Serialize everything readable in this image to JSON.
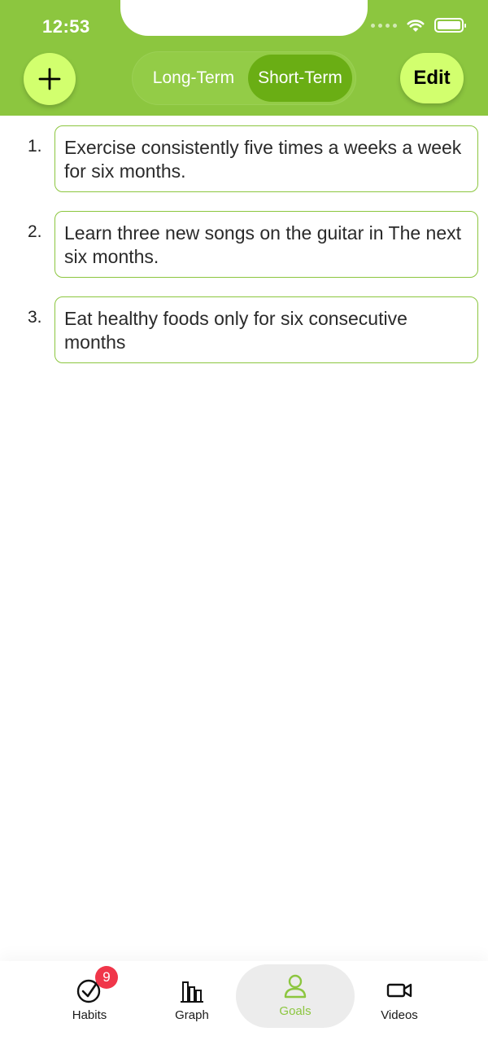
{
  "status_bar": {
    "time": "12:53"
  },
  "header": {
    "add_icon": "plus-icon",
    "tabs": [
      {
        "label": "Long-Term",
        "selected": false
      },
      {
        "label": "Short-Term",
        "selected": true
      }
    ],
    "edit_label": "Edit"
  },
  "goals": [
    {
      "number": "1.",
      "text": "Exercise consistently five times a weeks a week for six months."
    },
    {
      "number": "2.",
      "text": "Learn three new songs on the guitar in The next six months."
    },
    {
      "number": "3.",
      "text": "Eat healthy foods only for six consecutive months"
    }
  ],
  "tabbar": {
    "items": [
      {
        "label": "Habits",
        "icon": "check-circle-icon",
        "badge": "9"
      },
      {
        "label": "Graph",
        "icon": "bar-chart-icon"
      },
      {
        "label": "Goals",
        "icon": "person-icon",
        "active": true
      },
      {
        "label": "Videos",
        "icon": "video-camera-icon"
      }
    ]
  },
  "colors": {
    "header_green": "#8cc63f",
    "accent_lime": "#d2ff6e",
    "selected_segment": "#6aae14",
    "badge_red": "#f0364a"
  }
}
